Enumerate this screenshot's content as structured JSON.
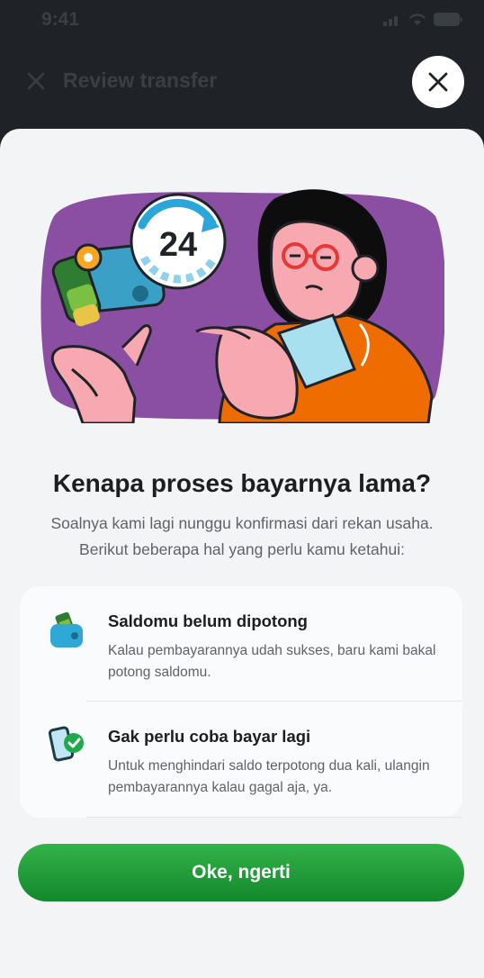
{
  "status_bar": {
    "time": "9:41"
  },
  "background": {
    "title": "Review transfer"
  },
  "sheet": {
    "title": "Kenapa proses bayarnya lama?",
    "subtitle_line1": "Soalnya kami lagi nunggu konfirmasi dari rekan usaha.",
    "subtitle_line2": "Berikut beberapa hal yang perlu kamu ketahui:",
    "items": [
      {
        "icon": "wallet-icon",
        "title": "Saldomu belum dipotong",
        "description": "Kalau pembayarannya udah sukses, baru kami bakal potong saldomu."
      },
      {
        "icon": "phone-check-icon",
        "title": "Gak perlu coba bayar lagi",
        "description": "Untuk menghindari saldo terpotong dua kali, ulangin pembayarannya kalau gagal aja, ya."
      }
    ],
    "cta_label": "Oke, ngerti"
  },
  "illustration": {
    "clock_number": "24"
  },
  "colors": {
    "accent": "#1b9a36",
    "illustration_bg": "#8a4fa3"
  }
}
